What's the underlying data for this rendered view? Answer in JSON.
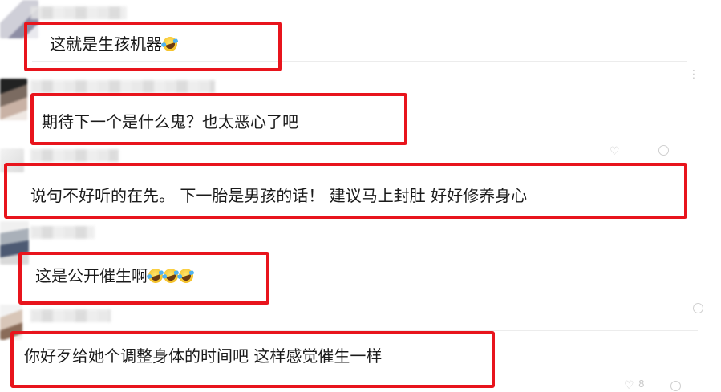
{
  "comments": [
    {
      "text": "这就是生孩机器",
      "emoji_count": 1,
      "emoji_name": "laughing-tears-emoji"
    },
    {
      "text": "期待下一个是什么鬼？也太恶心了吧",
      "emoji_count": 0
    },
    {
      "text": "说句不好听的在先。 下一胎是男孩的话！ 建议马上封肚 好好修养身心",
      "emoji_count": 0
    },
    {
      "text": "这是公开催生啊",
      "emoji_count": 3,
      "emoji_name": "laughing-tears-emoji"
    },
    {
      "text": "你好歹给她个调整身体的时间吧 这样感觉催生一样",
      "emoji_count": 0
    }
  ],
  "faint": {
    "like_count_last": "8"
  },
  "colors": {
    "highlight": "#e8141c",
    "text": "#1a1a1a",
    "background": "#ffffff"
  }
}
